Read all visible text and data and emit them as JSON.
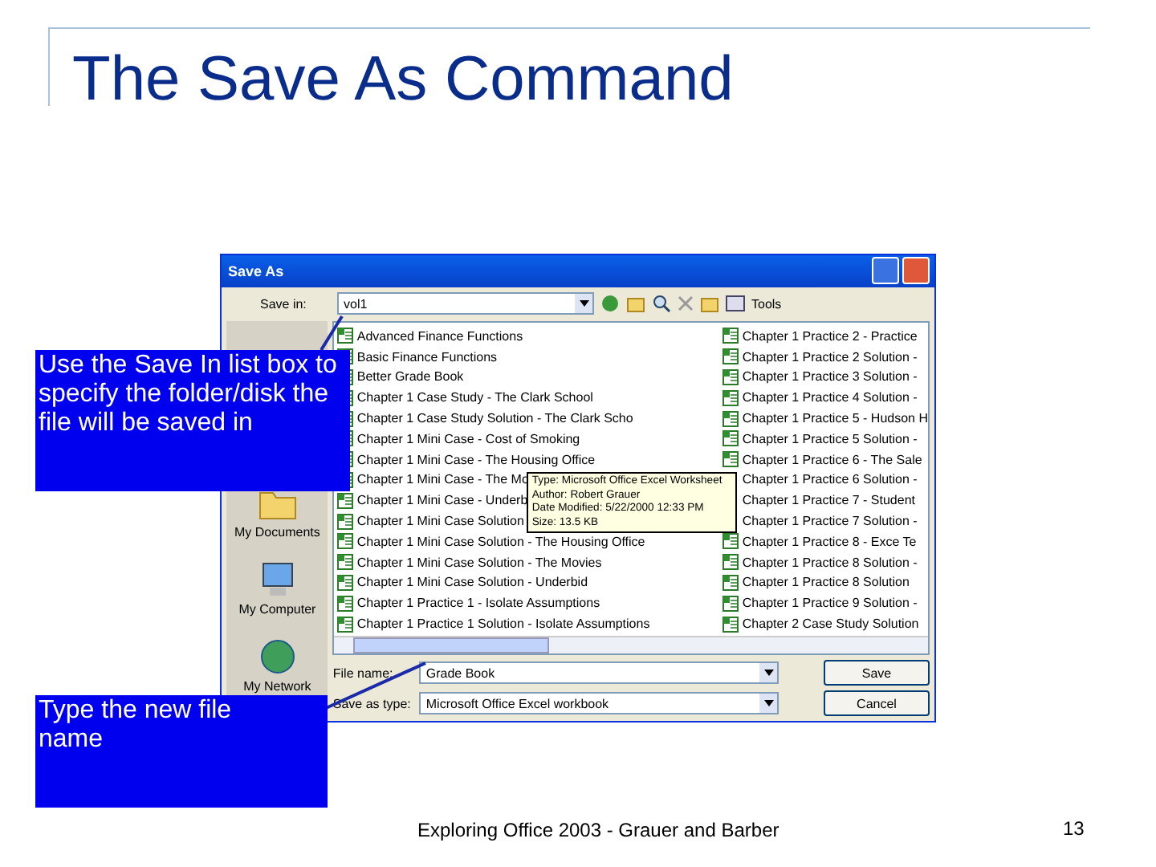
{
  "slide": {
    "title": "The Save As Command",
    "footer": "Exploring Office 2003 - Grauer and Barber",
    "page_number": "13"
  },
  "dialog": {
    "title": "Save As",
    "save_in_label": "Save in:",
    "save_in_value": "vol1",
    "tools_label": "Tools",
    "places": [
      "My Documents",
      "My Computer",
      "My Network"
    ],
    "files_left": [
      "Advanced Finance Functions",
      "Basic Finance Functions",
      "Better Grade Book",
      "Chapter 1 Case Study - The Clark School",
      "Chapter 1 Case Study Solution - The Clark Scho",
      "Chapter 1 Mini Case - Cost of Smoking",
      "Chapter 1 Mini Case - The Housing Office",
      "Chapter 1 Mini Case - The Mo",
      "Chapter 1 Mini Case - Underb",
      "Chapter 1 Mini Case Solution",
      "Chapter 1 Mini Case Solution - The Housing Office",
      "Chapter 1 Mini Case Solution - The Movies",
      "Chapter 1 Mini Case Solution - Underbid",
      "Chapter 1 Practice 1 - Isolate Assumptions",
      "Chapter 1 Practice 1 Solution - Isolate Assumptions"
    ],
    "files_right": [
      "Chapter 1 Practice 2 - Practice",
      "Chapter 1 Practice 2 Solution -",
      "Chapter 1 Practice 3 Solution -",
      "Chapter 1 Practice 4 Solution -",
      "Chapter 1 Practice 5 - Hudson H",
      "Chapter 1 Practice 5 Solution -",
      "Chapter 1 Practice 6 - The Sale",
      "Chapter 1 Practice 6 Solution -",
      "Chapter 1 Practice 7 - Student",
      "Chapter 1 Practice 7 Solution -",
      "Chapter 1 Practice 8 - Exce Te",
      "Chapter 1 Practice 8 Solution -",
      "Chapter 1 Practice 8 Solution",
      "Chapter 1 Practice 9 Solution -",
      "Chapter 2 Case Study Solution"
    ],
    "tooltip": [
      "Type: Microsoft Office Excel Worksheet",
      "Author: Robert Grauer",
      "Date Modified: 5/22/2000 12:33 PM",
      "Size: 13.5 KB"
    ],
    "file_name_label": "File name:",
    "file_name": "Grade Book",
    "type_label": "Save as type:",
    "type_value": "Microsoft Office Excel workbook",
    "buttons": [
      "Save",
      "Cancel"
    ]
  },
  "callouts": [
    {
      "text": "Use the Save In list box to specify the folder/disk the file will be saved in"
    },
    {
      "text": "Type the new file name"
    }
  ]
}
